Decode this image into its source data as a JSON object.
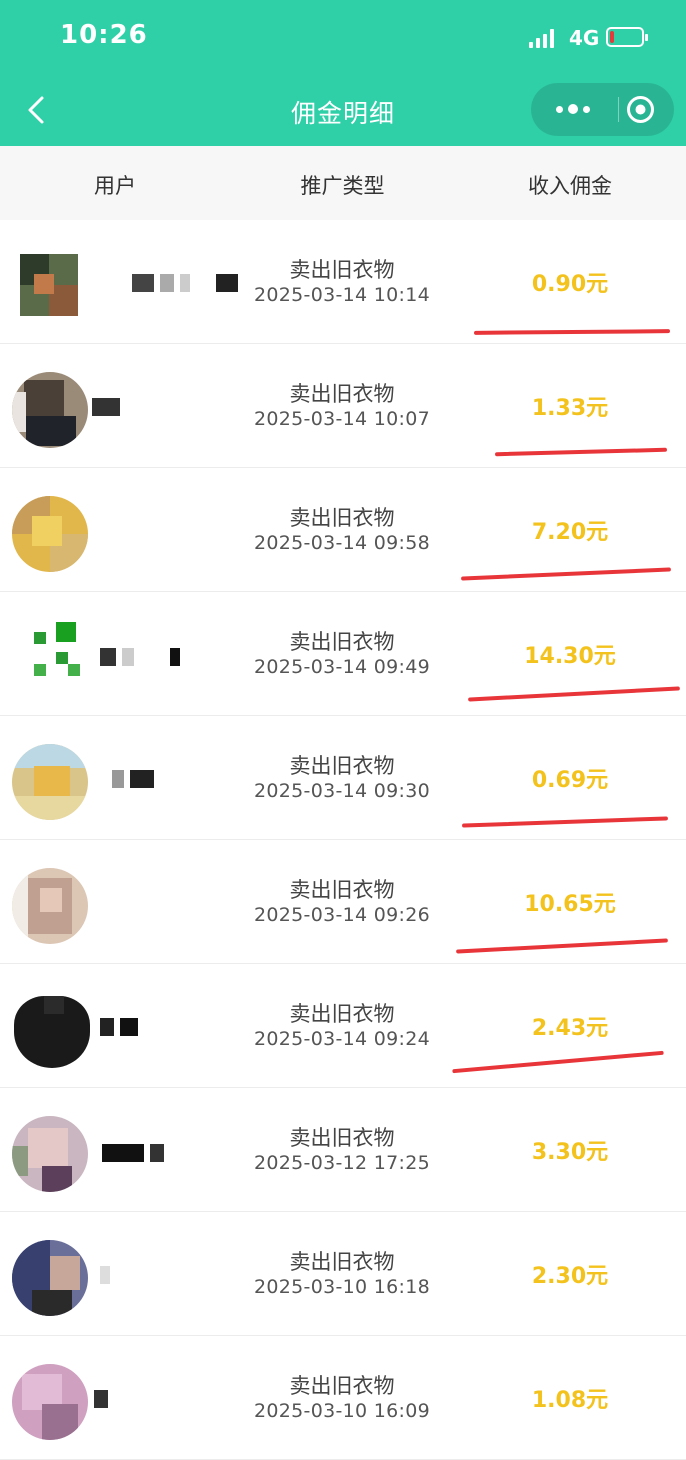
{
  "status_bar": {
    "time": "10:26",
    "network": "4G",
    "icons": [
      "signal-icon",
      "battery-icon"
    ]
  },
  "nav": {
    "title": "佣金明细",
    "icons": [
      "back-chevron-icon",
      "more-dots-icon",
      "target-circle-icon"
    ]
  },
  "table": {
    "headers": [
      "用户",
      "推广类型",
      "收入佣金"
    ],
    "rows": [
      {
        "type": "卖出旧衣物",
        "datetime": "2025-03-14 10:14",
        "amount": "0.90元",
        "underlined": true
      },
      {
        "type": "卖出旧衣物",
        "datetime": "2025-03-14 10:07",
        "amount": "1.33元",
        "underlined": true
      },
      {
        "type": "卖出旧衣物",
        "datetime": "2025-03-14 09:58",
        "amount": "7.20元",
        "underlined": true
      },
      {
        "type": "卖出旧衣物",
        "datetime": "2025-03-14 09:49",
        "amount": "14.30元",
        "underlined": true
      },
      {
        "type": "卖出旧衣物",
        "datetime": "2025-03-14 09:30",
        "amount": "0.69元",
        "underlined": true
      },
      {
        "type": "卖出旧衣物",
        "datetime": "2025-03-14 09:26",
        "amount": "10.65元",
        "underlined": true
      },
      {
        "type": "卖出旧衣物",
        "datetime": "2025-03-14 09:24",
        "amount": "2.43元",
        "underlined": true
      },
      {
        "type": "卖出旧衣物",
        "datetime": "2025-03-12 17:25",
        "amount": "3.30元",
        "underlined": false
      },
      {
        "type": "卖出旧衣物",
        "datetime": "2025-03-10 16:18",
        "amount": "2.30元",
        "underlined": false
      },
      {
        "type": "卖出旧衣物",
        "datetime": "2025-03-10 16:09",
        "amount": "1.08元",
        "underlined": false
      }
    ]
  },
  "colors": {
    "brand_green": "#2fcfa8",
    "amount_yellow": "#f3c21c",
    "annotation_red": "#e8353a"
  }
}
